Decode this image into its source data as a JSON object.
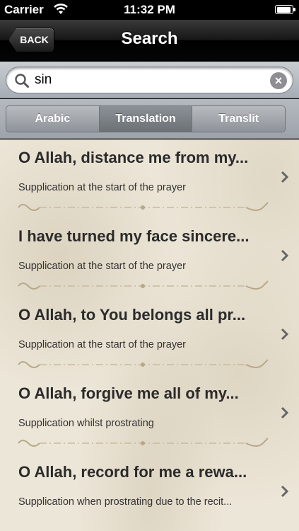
{
  "status_bar": {
    "carrier": "Carrier",
    "time": "11:32 PM"
  },
  "nav": {
    "back_label": "BACK",
    "title": "Search"
  },
  "search": {
    "value": "sin",
    "clear_symbol": "×"
  },
  "segments": [
    {
      "label": "Arabic",
      "selected": false
    },
    {
      "label": "Translation",
      "selected": true
    },
    {
      "label": "Translit",
      "selected": false
    }
  ],
  "results": [
    {
      "title": "O Allah, distance me from my...",
      "subtitle": "Supplication at the start of the prayer"
    },
    {
      "title": "I have turned my face sincere...",
      "subtitle": "Supplication at the start of the prayer"
    },
    {
      "title": "O Allah, to You belongs all pr...",
      "subtitle": "Supplication at the start of the prayer"
    },
    {
      "title": "O Allah, forgive me all of my...",
      "subtitle": "Supplication whilst prostrating"
    },
    {
      "title": "O Allah, record for me a rewa...",
      "subtitle": "Supplication when prostrating due to the recit..."
    }
  ],
  "colors": {
    "nav_bg": "#000000",
    "list_bg": "#ece6d8",
    "ornament": "#b8a88a"
  }
}
